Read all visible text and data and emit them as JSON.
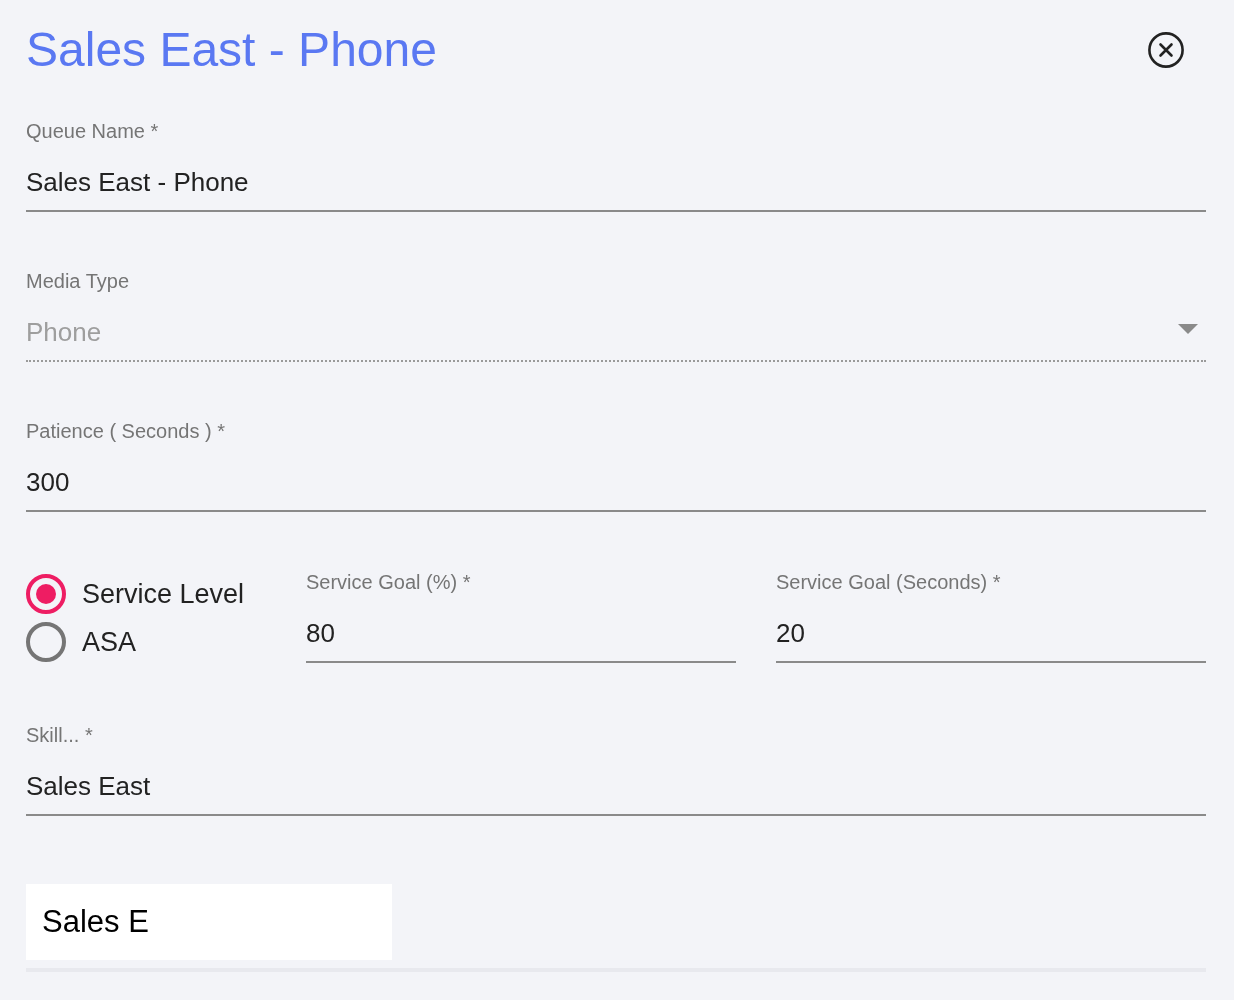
{
  "dialog": {
    "title": "Sales East - Phone"
  },
  "fields": [
    {
      "kind": "text",
      "label": "Queue Name *",
      "value": "Sales East - Phone",
      "disabled": false
    },
    {
      "kind": "select",
      "label": "Media Type",
      "value": "Phone",
      "disabled": true
    },
    {
      "kind": "text",
      "label": "Patience ( Seconds ) *",
      "value": "300",
      "disabled": false
    }
  ],
  "goal_type": {
    "options": [
      {
        "label": "Service Level",
        "selected": true
      },
      {
        "label": "ASA",
        "selected": false
      }
    ]
  },
  "goal_fields": [
    {
      "label": "Service Goal (%) *",
      "value": "80"
    },
    {
      "label": "Service Goal (Seconds) *",
      "value": "20"
    }
  ],
  "skill_field": {
    "label": "Skill... *",
    "value": "Sales East"
  },
  "search_input": {
    "value": "Sales E"
  }
}
